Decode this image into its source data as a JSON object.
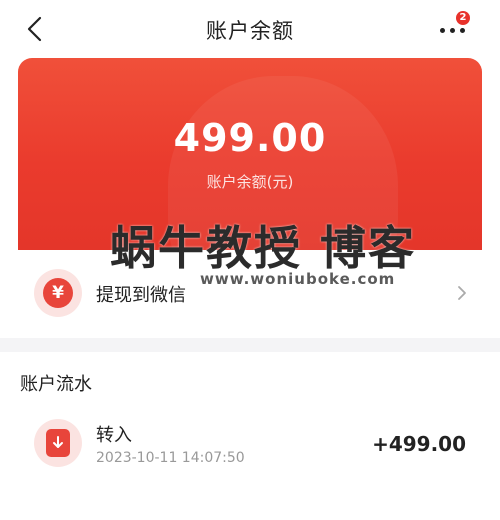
{
  "header": {
    "title": "账户余额",
    "back_icon": "chevron-left-icon",
    "more_icon": "more-dots-icon",
    "badge_count": "2"
  },
  "balance": {
    "amount": "499.00",
    "label": "账户余额(元)"
  },
  "withdraw": {
    "icon_glyph": "¥",
    "label": "提现到微信",
    "chevron_icon": "chevron-right-icon"
  },
  "transactions": {
    "title": "账户流水",
    "items": [
      {
        "name": "转入",
        "time": "2023-10-11 14:07:50",
        "amount": "+499.00",
        "icon": "transfer-in-icon"
      }
    ]
  },
  "watermark": {
    "main": "蜗牛教授 博客",
    "sub": "www.woniuboke.com"
  },
  "colors": {
    "accent": "#e8453b",
    "card_top": "#f0503a",
    "card_bottom": "#e4362a",
    "badge": "#e8322b",
    "background": "#f4f4f6"
  }
}
